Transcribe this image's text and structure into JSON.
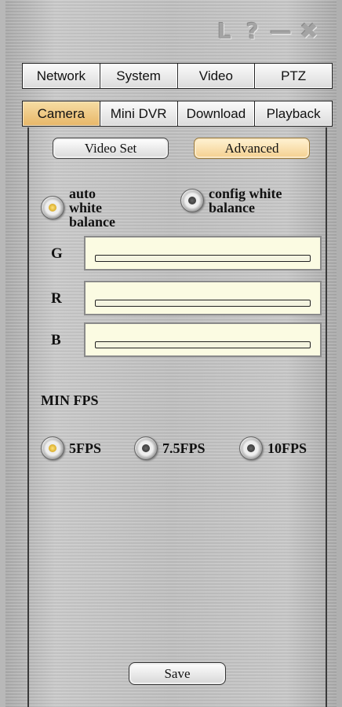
{
  "window": {
    "icons": [
      "restore-icon",
      "help-icon",
      "minimize-icon",
      "close-icon"
    ],
    "icon_glyphs": [
      "L",
      "?",
      "—",
      "✖"
    ]
  },
  "tabs_row1": [
    {
      "label": "Network"
    },
    {
      "label": "System"
    },
    {
      "label": "Video"
    },
    {
      "label": "PTZ"
    }
  ],
  "tabs_row2": [
    {
      "label": "Camera",
      "active": true
    },
    {
      "label": "Mini DVR"
    },
    {
      "label": "Download"
    },
    {
      "label": "Playback"
    }
  ],
  "subtabs": {
    "video_set": "Video Set",
    "advanced": "Advanced",
    "active": "advanced"
  },
  "white_balance": {
    "auto_label": "auto white balance",
    "config_label": "config white balance",
    "selected": "auto"
  },
  "sliders": {
    "g_label": "G",
    "r_label": "R",
    "b_label": "B"
  },
  "min_fps": {
    "title": "MIN FPS",
    "options": [
      "5FPS",
      "7.5FPS",
      "10FPS"
    ],
    "selected": "5FPS"
  },
  "save_label": "Save",
  "colors": {
    "active_tab": "#e8b86a",
    "slider_bg": "#fbfbe2",
    "radio_selected": "#c8960a"
  }
}
